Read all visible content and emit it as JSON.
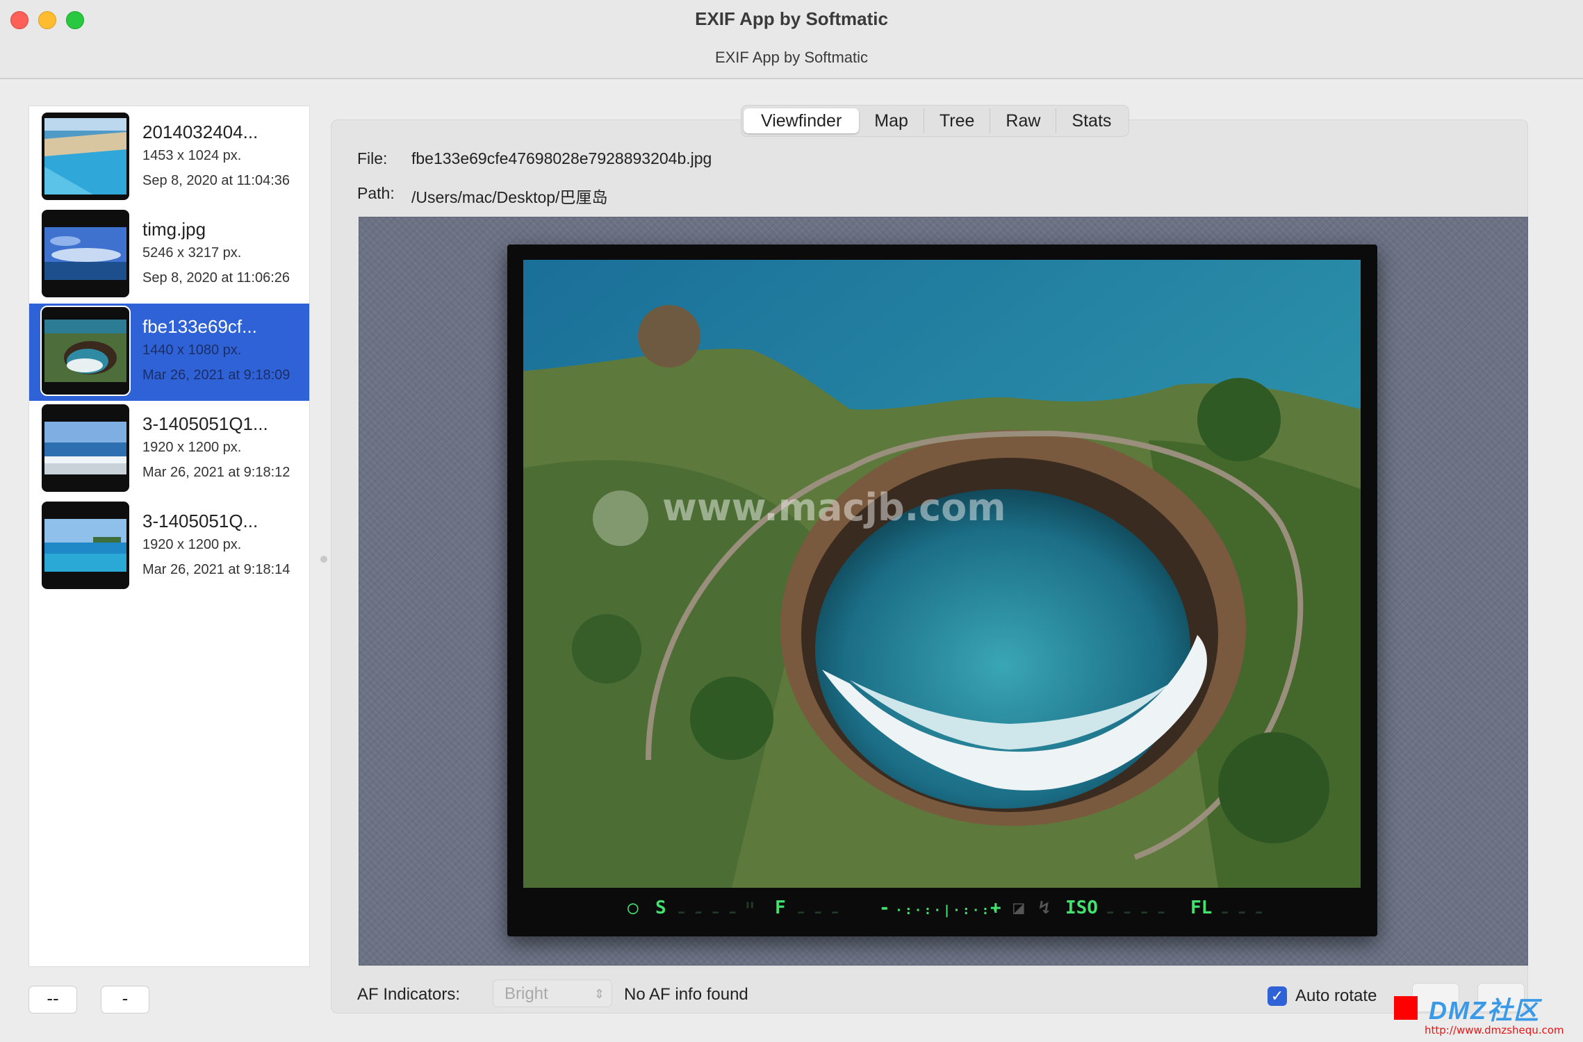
{
  "window": {
    "title": "EXIF App by Softmatic",
    "subtitle": "EXIF App by Softmatic"
  },
  "files": [
    {
      "name": "2014032404...",
      "dims": "1453 x 1024 px.",
      "date": "Sep 8, 2020 at 11:04:36"
    },
    {
      "name": "timg.jpg",
      "dims": "5246 x 3217 px.",
      "date": "Sep 8, 2020 at 11:06:26"
    },
    {
      "name": "fbe133e69cf...",
      "dims": "1440 x 1080 px.",
      "date": "Mar 26, 2021 at 9:18:09",
      "selected": true
    },
    {
      "name": "3-1405051Q1...",
      "dims": "1920 x 1200 px.",
      "date": "Mar 26, 2021 at 9:18:12"
    },
    {
      "name": "3-1405051Q...",
      "dims": "1920 x 1200 px.",
      "date": "Mar 26, 2021 at 9:18:14"
    }
  ],
  "sidebar_buttons": {
    "add_label": "--",
    "remove_label": "-"
  },
  "tabs": [
    "Viewfinder",
    "Map",
    "Tree",
    "Raw",
    "Stats"
  ],
  "active_tab": "Viewfinder",
  "info": {
    "file_label": "File:",
    "file_value": "fbe133e69cfe47698028e7928893204b.jpg",
    "path_label": "Path:",
    "path_value": "/Users/mac/Desktop/巴厘岛"
  },
  "viewfinder": {
    "watermark": "www.macjb.com",
    "lcd": {
      "s_label": "S",
      "s_value": "----\"",
      "f_label": "F",
      "f_value": "---",
      "minus": "-",
      "plus": "+",
      "iso_label": "ISO",
      "iso_value": "----",
      "fl_label": "FL",
      "fl_value": "---"
    }
  },
  "controls": {
    "af_label": "AF Indicators:",
    "af_select_value": "Bright",
    "af_info": "No AF info found",
    "auto_rotate_label": "Auto rotate",
    "auto_rotate_checked": true
  },
  "overlay": {
    "dmz_text": "DMZ社区",
    "dmz_url": "http://www.dmzshequ.com"
  },
  "colors": {
    "selection": "#2f62d6",
    "lcd_green": "#41e26f",
    "viewer_bg": "#6b7284"
  }
}
